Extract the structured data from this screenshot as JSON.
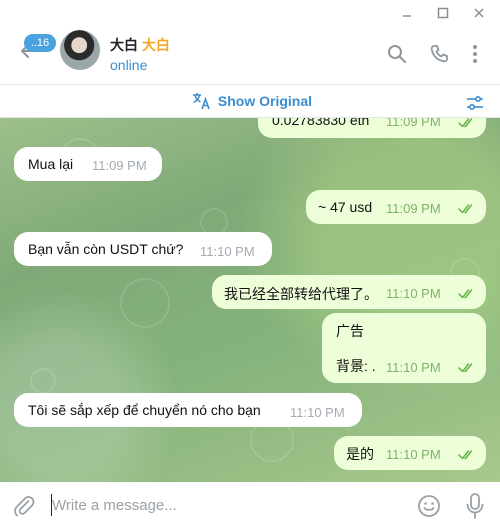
{
  "window": {
    "minimize_icon": "minimize-icon",
    "maximize_icon": "maximize-icon",
    "close_icon": "close-icon"
  },
  "header": {
    "unread_count": "..16",
    "contact_name": "大白",
    "contact_emoji": "大白",
    "status": "online"
  },
  "translate_bar": {
    "label": "Show Original"
  },
  "messages": [
    {
      "dir": "out",
      "text": "0.02783830 eth",
      "time": "11:09 PM",
      "ticks": "read"
    },
    {
      "dir": "in",
      "text": "Mua lại",
      "time": "11:09 PM"
    },
    {
      "dir": "out",
      "text": "~ 47 usd",
      "time": "11:09 PM",
      "ticks": "read"
    },
    {
      "dir": "in",
      "text": "Bạn vẫn còn USDT chứ?",
      "time": "11:10 PM"
    },
    {
      "dir": "out",
      "text": "我已经全部转给代理了。",
      "time": "11:10 PM",
      "ticks": "read"
    },
    {
      "dir": "out",
      "line1": "广告",
      "line2": "背景: .",
      "time": "11:10 PM",
      "ticks": "read"
    },
    {
      "dir": "in",
      "text": "Tôi sẽ sắp xếp để chuyển nó cho bạn",
      "time": "11:10 PM"
    },
    {
      "dir": "out",
      "text": "是的",
      "time": "11:10 PM",
      "ticks": "read"
    }
  ],
  "composer": {
    "placeholder": "Write a message..."
  },
  "colors": {
    "accent": "#3a8dd0",
    "incoming": "#ffffff",
    "outgoing": "#eefed9",
    "read_ticks": "#5fb444"
  }
}
